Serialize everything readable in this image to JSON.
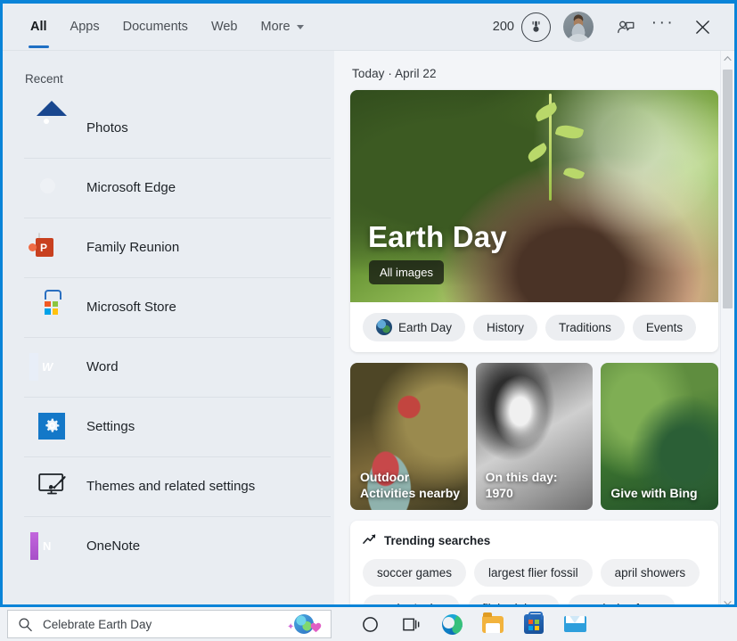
{
  "window": {
    "accent_color": "#0a84d8",
    "header_bg": "#e9edf2",
    "panel_bg": "#f3f5f8"
  },
  "header": {
    "tabs": [
      {
        "label": "All",
        "active": true
      },
      {
        "label": "Apps",
        "active": false
      },
      {
        "label": "Documents",
        "active": false
      },
      {
        "label": "Web",
        "active": false
      },
      {
        "label": "More",
        "active": false,
        "has_dropdown": true
      }
    ],
    "rewards_count": "200",
    "rewards_icon": "rewards-medal-icon",
    "avatar_icon": "account-avatar",
    "feedback_icon": "feedback-person-icon",
    "more_options_icon": "ellipsis-icon",
    "close_icon": "close-icon"
  },
  "sidebar": {
    "section_label": "Recent",
    "items": [
      {
        "label": "Photos",
        "icon": "photos-icon"
      },
      {
        "label": "Microsoft Edge",
        "icon": "edge-icon"
      },
      {
        "label": "Family Reunion",
        "icon": "powerpoint-file-icon"
      },
      {
        "label": "Microsoft Store",
        "icon": "store-icon"
      },
      {
        "label": "Word",
        "icon": "word-icon"
      },
      {
        "label": "Settings",
        "icon": "settings-gear-icon"
      },
      {
        "label": "Themes and related settings",
        "icon": "themes-icon"
      },
      {
        "label": "OneNote",
        "icon": "onenote-icon"
      }
    ]
  },
  "content": {
    "today_line": "Today  ·  April 22",
    "hero": {
      "title": "Earth Day",
      "badge": "All images",
      "chips": [
        {
          "label": "Earth Day",
          "icon": "globe-icon"
        },
        {
          "label": "History"
        },
        {
          "label": "Traditions"
        },
        {
          "label": "Events"
        }
      ]
    },
    "tiles": [
      {
        "label": "Outdoor\nActivities nearby",
        "style": "outdoor"
      },
      {
        "label": "On this day: 1970",
        "style": "bw"
      },
      {
        "label": "Give with Bing",
        "style": "green"
      }
    ],
    "trending": {
      "heading": "Trending searches",
      "icon": "trending-arrow-icon",
      "terms": [
        "soccer games",
        "largest flier fossil",
        "april showers",
        "mother's day",
        "flight delays",
        "earth day facts"
      ]
    }
  },
  "taskbar": {
    "search_value": "Celebrate Earth Day",
    "search_icon": "search-magnifier-icon",
    "search_art_icon": "earth-day-globe-heart-icon",
    "icons": [
      {
        "name": "cortana-icon"
      },
      {
        "name": "task-view-icon"
      },
      {
        "name": "edge-icon"
      },
      {
        "name": "file-explorer-icon"
      },
      {
        "name": "microsoft-store-icon"
      },
      {
        "name": "mail-icon"
      }
    ]
  }
}
